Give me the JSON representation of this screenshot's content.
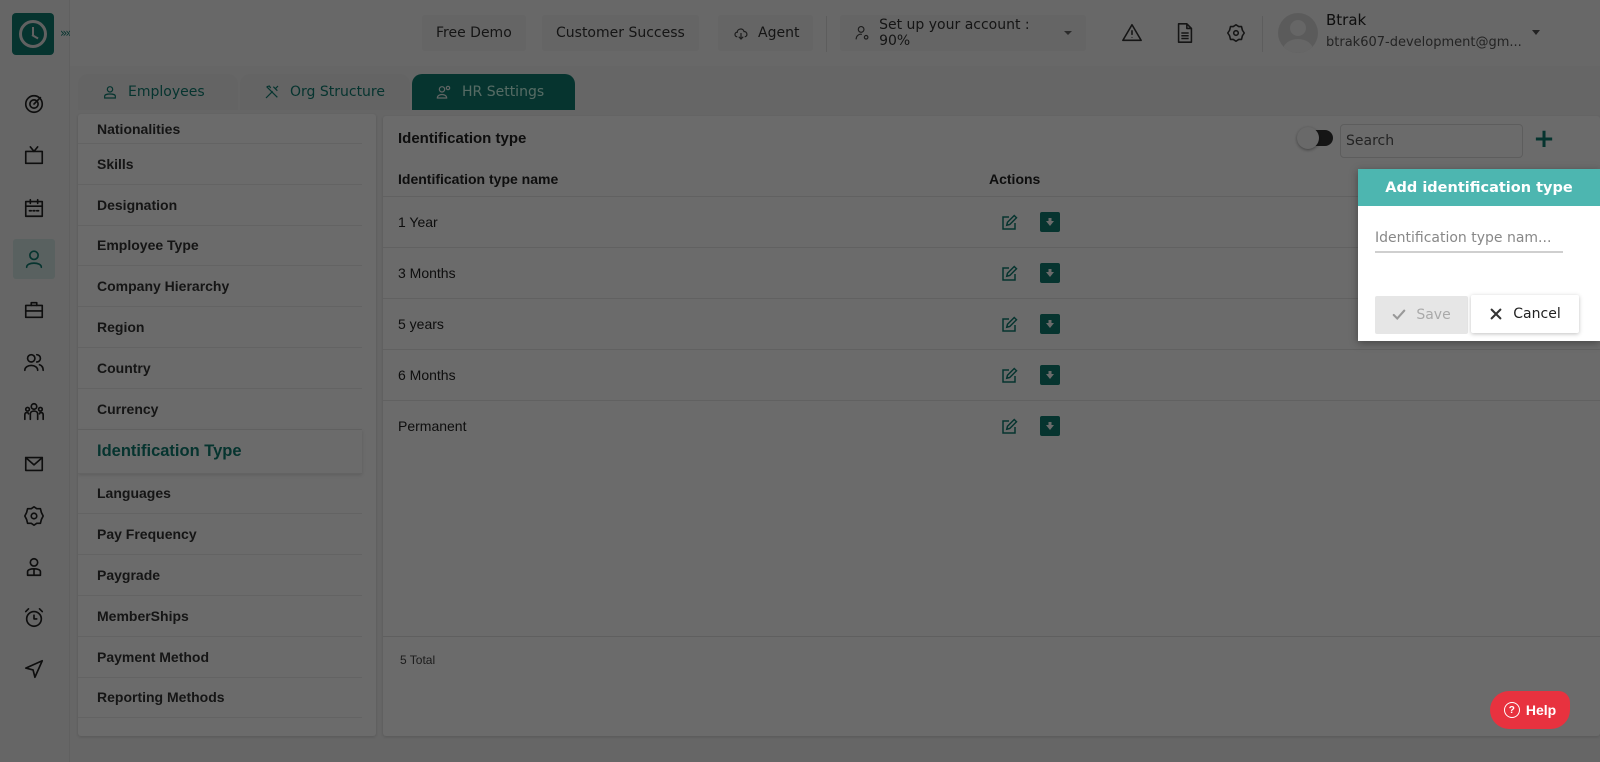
{
  "header": {
    "free_demo": "Free Demo",
    "customer_success": "Customer Success",
    "agent": "Agent",
    "setup": "Set up your account : 90%",
    "setup_progress_percent": 90,
    "user_name": "Btrak",
    "user_email": "btrak607-development@gm..."
  },
  "rail": {
    "expand_label": "»»",
    "items": [
      "dashboard",
      "tv",
      "calendar",
      "employee",
      "briefcase",
      "users",
      "team",
      "mail",
      "settings",
      "profile",
      "alarm",
      "send"
    ],
    "active": "employee"
  },
  "tabs": [
    {
      "label": "Employees",
      "icon": "person-icon"
    },
    {
      "label": "Org Structure",
      "icon": "tools-icon"
    },
    {
      "label": "HR Settings",
      "icon": "user-cog-icon",
      "active": true
    }
  ],
  "settings_list": [
    "Nationalities",
    "Skills",
    "Designation",
    "Employee Type",
    "Company Hierarchy",
    "Region",
    "Country",
    "Currency",
    "Identification Type",
    "Languages",
    "Pay Frequency",
    "Paygrade",
    "MemberShips",
    "Payment Method",
    "Reporting Methods"
  ],
  "settings_active": "Identification Type",
  "panel": {
    "title": "Identification type",
    "search_placeholder": "Search",
    "add_label": "+",
    "columns": [
      "Identification type name",
      "Actions"
    ],
    "rows": [
      "1 Year",
      "3 Months",
      "5 years",
      "6 Months",
      "Permanent"
    ],
    "total": "5 Total"
  },
  "popover": {
    "title": "Add identification type",
    "input_placeholder": "Identification type nam...",
    "save_label": "Save",
    "cancel_label": "Cancel"
  },
  "help": {
    "label": "Help"
  },
  "colors": {
    "brand": "#0f7c70",
    "popover_header": "#4db6b0",
    "help": "#e8323f"
  }
}
